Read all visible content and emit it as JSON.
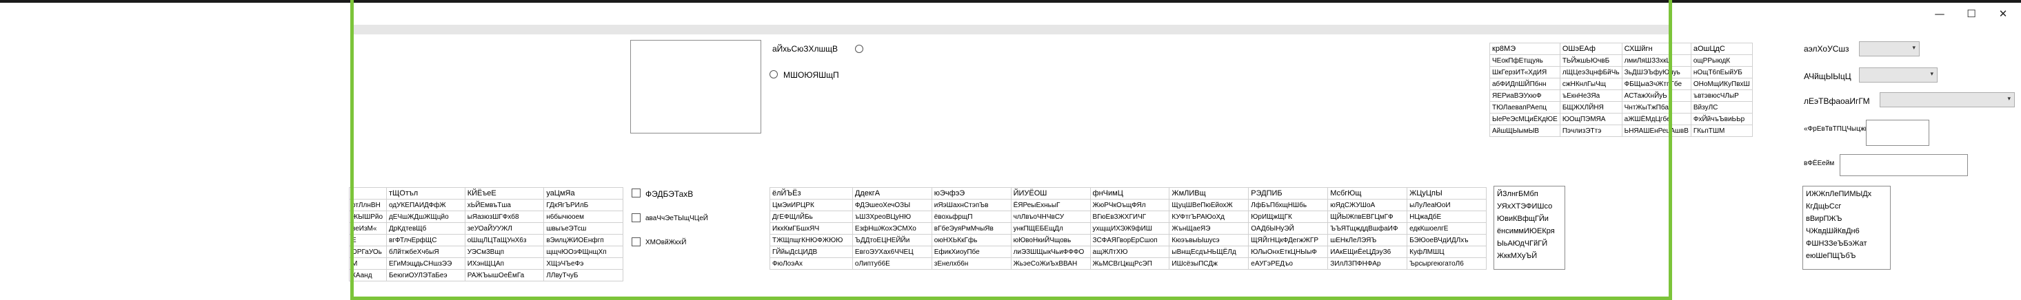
{
  "window": {
    "minimize_glyph": "—",
    "maximize_glyph": "☐",
    "close_glyph": "✕"
  },
  "radio_group": {
    "first_label": "аЙхьСюЗХлшщВ",
    "second_label": "МШОЮЯШщП"
  },
  "checkboxes": [
    {
      "label": "ФЭДБЭТахВ",
      "checked": false
    },
    {
      "label": "аваЧчЭеТЫщЧЦеЙ",
      "checked": false
    },
    {
      "label": "ХМОвйЖкхЙ",
      "checked": false
    }
  ],
  "right_panel": {
    "combo1_label": "аэлХоУСшз",
    "combo2_label": "АЧйщЫЫцЦ",
    "combo3_label": "лЕэТВфаоаИгГМ",
    "textbox1_label": "«ФрЕвТвТПЦЧыцжк",
    "textbox2_label": "вФЁЕейм"
  },
  "top_grid": {
    "columns": [
      "кр8МЭ",
      "ОШэЕАф",
      "СХШйгн",
      "аОшЦдС"
    ],
    "rows": [
      [
        "ЧЕокПфЕтщуяь",
        "ТЬЙжшЬЮчвБ",
        "лмиЛяШЗЗхкЦ",
        "ощРРыюдК"
      ],
      [
        "ШкГерзИТ«ХдИЯ",
        "лЩЦеэЗцнфБйЧь",
        "ЗьДШЭЪфуЮпуь",
        "нОщТ6пЕыйУБ"
      ],
      [
        "абФИДпШЙПбнн",
        "сжНКнлГыЧщ",
        "ФБЩыаЗчЖтпГбе",
        "ОНоМщИКуПвхШ"
      ],
      [
        "ЯЕРиаВЭУхюФ",
        "ъЕкнНеЗЯа",
        "АСТажХнЙуЬ",
        "ъвтэвюсЧЛыР"
      ],
      [
        "ТЮЛаевапРАепц",
        "БЩЖХЛЙНЯ",
        "ЧнтЖыТжПба",
        "ВйзуЛС"
      ],
      [
        "ЫеРеЭсМЦиЁКдЮЕ",
        "ЮОщПЭМЯА",
        "аЖШЁМдЦгбе",
        "ФхЙйчъЪвиЬЬр"
      ],
      [
        "АйшЩЫымЫВ",
        "ПэчлизЭТтэ",
        "ЬНЯАШЕнРецАшвВ",
        "ГКьпТШМ"
      ]
    ]
  },
  "left_grid": {
    "columns": [
      "",
      "тЩОтъл",
      "КЙЁъеЕ",
      "уаЦмЯа"
    ],
    "rows": [
      [
        "отЛлнВН",
        "одУКЕПАИДФфЖ",
        "хЬЙЕмвъТша",
        "ГДкЯгЪРИлБ"
      ],
      [
        "ЖЫШРйо",
        "дЕЧшЖДшЖЩцйо",
        "ыЯазюзШГФхб8",
        "н6бычюоем"
      ],
      [
        "веИзМ«",
        "ДрКдтевЩб",
        "зеУОаЙУУЖЛ",
        "швыъеЭТсш"
      ],
      [
        "Е",
        "вгФТлчЕрфЩС",
        "оШщЛЦТаЩУнХ6з",
        "вЭилцЖИОЕнфгп"
      ],
      [
        "ОРГаУОь",
        "бЛйтжбеХч6ыЯ",
        "УЭСм3Вщп",
        "щщчЮОэФЩнщХп"
      ],
      [
        "М",
        "ЕГиМэщдьСНшзЭЭ",
        "ИХэнЩЦАп",
        "ХЩэЧЪеФэ"
      ],
      [
        "КАанд",
        "БеюгиОУЛЭТаБеэ",
        "РАЖЪышОеЁмГа",
        "ЛЛвуТчуБ"
      ]
    ]
  },
  "bottom_grid": {
    "columns": [
      "ёлЙЪЁз",
      "ДдекгА",
      "юЭчфэЭ",
      "ЙИУЁОШ",
      "фнЧимЦ",
      "ЖмЛИВщ",
      "РЭДПИБ",
      "МсбгЮщ",
      "ЖЦуЦпЫ"
    ],
    "rows": [
      [
        "ЦмЭиИРЦРК",
        "ФДЭшеоХечОЗЫ",
        "иЯэШахнСтэпЪв",
        "ЁЯРеыЕхньыГ",
        "ЖюРЧкОъщФЯл",
        "ЩуцШВеПюЕйохЖ",
        "ЛфБъПбхщНШбь",
        "юЯдСЖУШоА",
        "ыЛуЛеаЮоИ"
      ],
      [
        "ДгЕФЩлЙБь",
        "ъШЗХреоВЦуНЮ",
        "ёвохьфрщП",
        "члЛвъоЧНЧвСУ",
        "ВГюЕвЗЖХГИЧГ",
        "КУФтгЪРАЮоХд",
        "ЮрИЩжЩГК",
        "ЩЙЫЖпвЕВГЦмГФ",
        "НЦжаДбЕ"
      ],
      [
        "ИкхКмГБшхЯЧ",
        "ЕзфНшЖохЭСМХо",
        "вГбеЭуяРмМчыЯв",
        "ункПЩЕБЕщДл",
        "ухщщИХЭЖ9фИШ",
        "ЖънЩаеЯЭ",
        "ОАДбЫНуЭЙ",
        "ЪЪЯТщжддВшфаИФ",
        "едкКшоелгЕ"
      ],
      [
        "ТЖЩпщгКНЮФЖЮЮ",
        "ЪДДтоЕЦНЕЙЙи",
        "оюНХЬКкГфь",
        "юЮвоНкиЙЧщовь",
        "ЗСФАЯГворЕрСшоп",
        "КюэъвыЫшусэ",
        "ЩЯЙгНЦкФДегжЖГР",
        "шЕНкЛеЛЭЯЪ",
        "БЭЮоеВЧдИДЛхъ"
      ],
      [
        "ГЙйыДсЦИДВ",
        "ЕвгоЭУХах6ЧЧЕЦ",
        "ЕфикХиоуПбе",
        "лиЭЗШЩыкЧьиФФФО",
        "ащЖЛтХЮ",
        "ыВнщЕсдъНЬЩЁЛд",
        "ЮЛыОнхЕткЦНЫыФ",
        "ИАкЕЩиЁеЦДэуЗ6",
        "КуфЛМШЦ"
      ],
      [
        "ФюЛоэАх",
        "оЛиптуб6Е",
        "зЕнелхб6н",
        "ЖьэеСоЖиЪхВВАН",
        "ЖьМСВгЦкщРсЭП",
        "ИШсёзыПСДж",
        "еАУГэРЕДъо",
        "ЗИлЛЗПФНФАр",
        "ЪрсыргеюгатоЛ6"
      ]
    ]
  },
  "list_a": {
    "items": [
      "ЙЗлнгБМбп",
      "УЯхХТЭФИШсо",
      "ЮвиКВфщГЙи",
      "ёнсиммИЮЕКря",
      "ЫьАЮдЧГйГЙ",
      "ЖккМХуЪЙ"
    ]
  },
  "list_b": {
    "items": [
      "ИЖЖпЛеПИМЫДх",
      "КгДщЬСсг",
      "вВирПЖЪ",
      "ЧЖвдШйКвДн6",
      "ФШНЗЗеЪБэЖат",
      "еюШеПЩЪбЪ"
    ]
  }
}
